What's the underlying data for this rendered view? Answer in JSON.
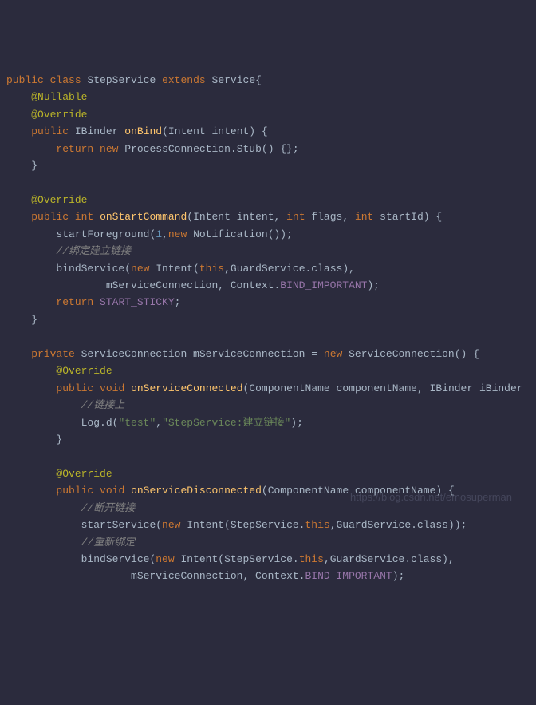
{
  "code": {
    "line1": {
      "public": "public",
      "class": "class",
      "className": "StepService",
      "extends": "extends",
      "parent": "Service",
      "brace": "{"
    },
    "line2": {
      "annotation": "@Nullable"
    },
    "line3": {
      "annotation": "@Override"
    },
    "line4": {
      "public": "public",
      "returnType": "IBinder",
      "method": "onBind",
      "params": "(Intent intent) {"
    },
    "line5": {
      "return": "return",
      "new": "new",
      "call": "ProcessConnection.Stub() {};"
    },
    "line6": {
      "brace": "}"
    },
    "line8": {
      "annotation": "@Override"
    },
    "line9": {
      "public": "public",
      "int": "int",
      "method": "onStartCommand",
      "paren": "(Intent intent, ",
      "int2": "int",
      "mid": " flags, ",
      "int3": "int",
      "end": " startId) {"
    },
    "line10": {
      "call": "startForeground(",
      "num": "1",
      "comma": ",",
      "new": "new",
      "rest": " Notification());"
    },
    "line11": {
      "comment": "//绑定建立链接"
    },
    "line12": {
      "call": "bindService(",
      "new": "new",
      "mid": " Intent(",
      "this": "this",
      "rest": ",GuardService.class),"
    },
    "line13": {
      "text": "mServiceConnection, Context.",
      "const": "BIND_IMPORTANT",
      "end": ");"
    },
    "line14": {
      "return": "return",
      "const": "START_STICKY",
      "end": ";"
    },
    "line15": {
      "brace": "}"
    },
    "line17": {
      "private": "private",
      "type": " ServiceConnection mServiceConnection = ",
      "new": "new",
      "rest": " ServiceConnection() {"
    },
    "line18": {
      "annotation": "@Override"
    },
    "line19": {
      "public": "public",
      "void": "void",
      "method": "onServiceConnected",
      "params": "(ComponentName componentName, IBinder iBinder"
    },
    "line20": {
      "comment": "//链接上"
    },
    "line21": {
      "call": "Log.d(",
      "str1": "\"test\"",
      "comma": ",",
      "str2": "\"StepService:建立链接\"",
      "end": ");"
    },
    "line22": {
      "brace": "}"
    },
    "line24": {
      "annotation": "@Override"
    },
    "line25": {
      "public": "public",
      "void": "void",
      "method": "onServiceDisconnected",
      "params": "(ComponentName componentName) {"
    },
    "line26": {
      "comment": "//断开链接"
    },
    "line27": {
      "call": "startService(",
      "new": "new",
      "mid": " Intent(StepService.",
      "this": "this",
      "rest": ",GuardService.class));"
    },
    "line28": {
      "comment": "//重新绑定"
    },
    "line29": {
      "call": "bindService(",
      "new": "new",
      "mid": " Intent(StepService.",
      "this": "this",
      "rest": ",GuardService.class),"
    },
    "line30": {
      "text": "mServiceConnection, Context.",
      "const": "BIND_IMPORTANT",
      "end": ");"
    }
  },
  "watermark": "https://blog.csdn.net/emosuperman"
}
